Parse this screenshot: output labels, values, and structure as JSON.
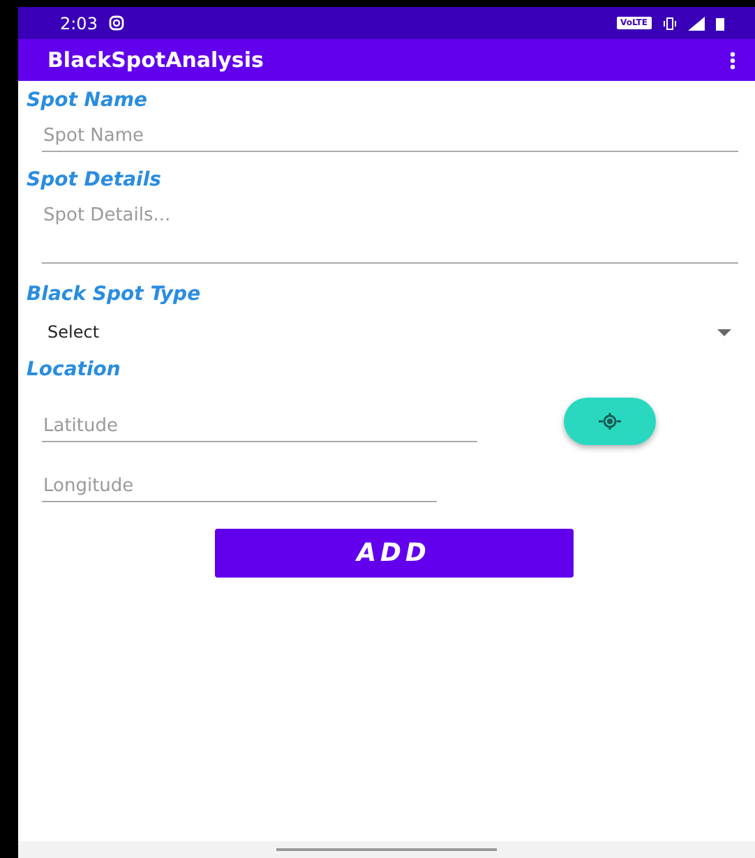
{
  "status_bar": {
    "time": "2:03",
    "badge": "VoLTE"
  },
  "app_bar": {
    "title": "BlackSpotAnalysis"
  },
  "form": {
    "spot_name": {
      "label": "Spot Name",
      "placeholder": "Spot Name"
    },
    "spot_details": {
      "label": "Spot Details",
      "placeholder": "Spot Details..."
    },
    "black_spot_type": {
      "label": "Black Spot Type",
      "value": "Select"
    },
    "location": {
      "label": "Location",
      "latitude_placeholder": "Latitude",
      "longitude_placeholder": "Longitude"
    },
    "submit": "ADD"
  }
}
